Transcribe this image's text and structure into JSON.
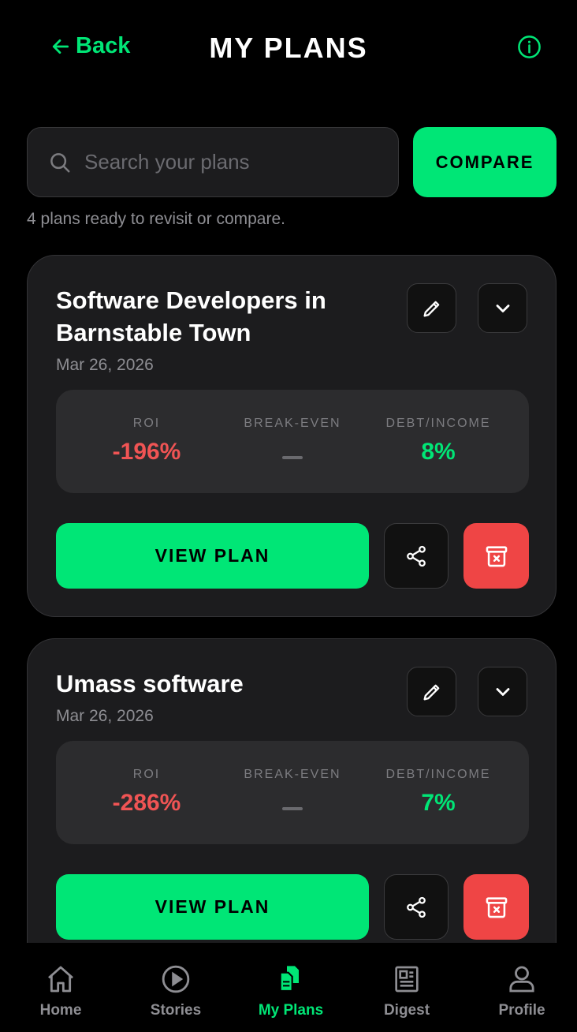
{
  "header": {
    "back_label": "Back",
    "title": "MY PLANS"
  },
  "search": {
    "placeholder": "Search your plans",
    "value": ""
  },
  "compare_label": "COMPARE",
  "summary_text": "4 plans ready to revisit or compare.",
  "stat_labels": {
    "roi": "ROI",
    "break_even": "BREAK-EVEN",
    "debt_income": "DEBT/INCOME"
  },
  "plans": [
    {
      "title": "Software Developers in Barnstable Town",
      "date": "Mar 26, 2026",
      "roi": "-196%",
      "break_even": "—",
      "debt_income": "8%",
      "view_label": "VIEW PLAN"
    },
    {
      "title": "Umass software",
      "date": "Mar 26, 2026",
      "roi": "-286%",
      "break_even": "—",
      "debt_income": "7%",
      "view_label": "VIEW PLAN"
    }
  ],
  "tabs": [
    {
      "label": "Home",
      "icon": "home-icon"
    },
    {
      "label": "Stories",
      "icon": "play-circle-icon"
    },
    {
      "label": "My Plans",
      "icon": "documents-icon",
      "active": true
    },
    {
      "label": "Digest",
      "icon": "newspaper-icon"
    },
    {
      "label": "Profile",
      "icon": "person-icon"
    }
  ],
  "colors": {
    "accent": "#00e676",
    "negative": "#f05454",
    "danger": "#ef4545",
    "card_bg": "#1c1c1e",
    "stats_bg": "#2c2c2e"
  }
}
